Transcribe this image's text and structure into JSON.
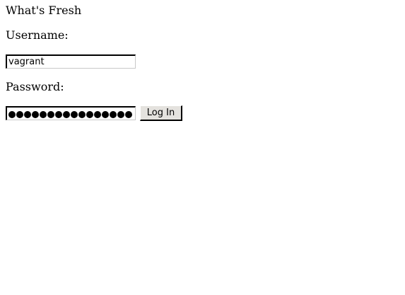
{
  "page": {
    "title": "What's Fresh"
  },
  "login_form": {
    "username_label": "Username:",
    "username_value": "vagrant",
    "password_label": "Password:",
    "password_masked_length": 16,
    "submit_label": "Log In"
  }
}
